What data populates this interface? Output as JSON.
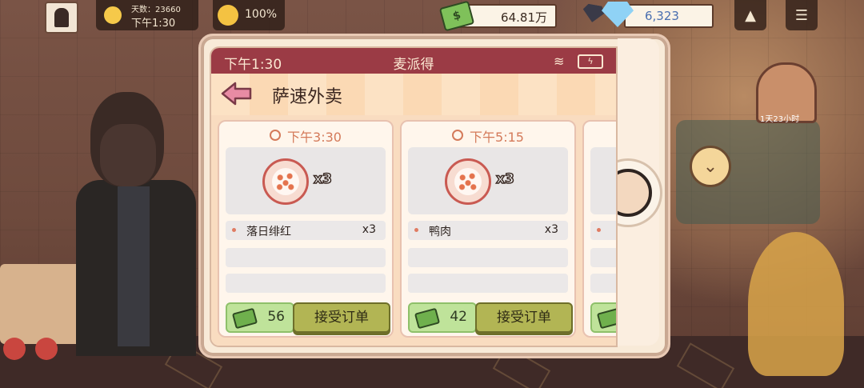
{
  "hud": {
    "day_label": "天数：23660",
    "time": "下午1:30",
    "mood_percent": "100%",
    "cash": "64.81万",
    "gems": "6,323",
    "up_button_icon": "chevron-up-icon",
    "menu_button_icon": "menu-icon"
  },
  "phone": {
    "status_time": "下午1:30",
    "status_title": "麦派得",
    "app_title": "萨速外卖",
    "orders": [
      {
        "deliver_time": "下午3:30",
        "item_icon": "pizza-icon",
        "quantity": "x3",
        "dish_name": "落日绯红",
        "dish_count": "x3",
        "reward": "56",
        "accept_label": "接受订单"
      },
      {
        "deliver_time": "下午5:15",
        "item_icon": "pizza-icon",
        "quantity": "x3",
        "dish_name": "鸭肉",
        "dish_count": "x3",
        "reward": "42",
        "accept_label": "接受订单"
      }
    ]
  },
  "background": {
    "oven_label": "1天23小时"
  },
  "colors": {
    "status_bar": "#9b3b45",
    "accept_button": "#b2b554",
    "reward_bg": "#bfe39a",
    "time_text": "#d47a5a"
  }
}
